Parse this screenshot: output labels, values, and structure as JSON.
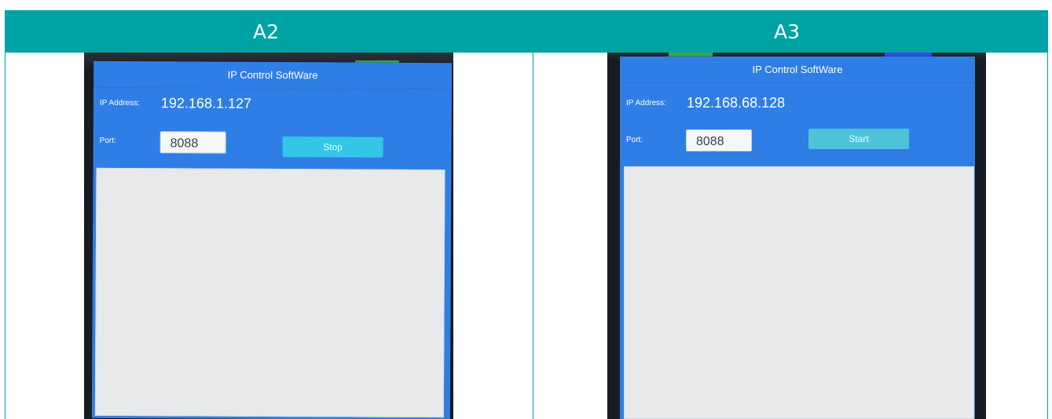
{
  "columns": [
    {
      "label": "A2"
    },
    {
      "label": "A3"
    }
  ],
  "screens": [
    {
      "title": "IP Control SoftWare",
      "ip_label": "IP Address:",
      "ip_value": "192.168.1.127",
      "port_label": "Port:",
      "port_value": "8088",
      "button_label": "Stop",
      "button_color": "#33c6e6"
    },
    {
      "title": "IP Control SoftWare",
      "ip_label": "IP Address:",
      "ip_value": "192.168.68.128",
      "port_label": "Port:",
      "port_value": "8088",
      "button_label": "Start",
      "button_color": "#4cc3d8"
    }
  ],
  "colors": {
    "header_bg": "#00a3a3",
    "app_bg": "#2f7ee6",
    "log_bg": "#e8e9ea"
  }
}
